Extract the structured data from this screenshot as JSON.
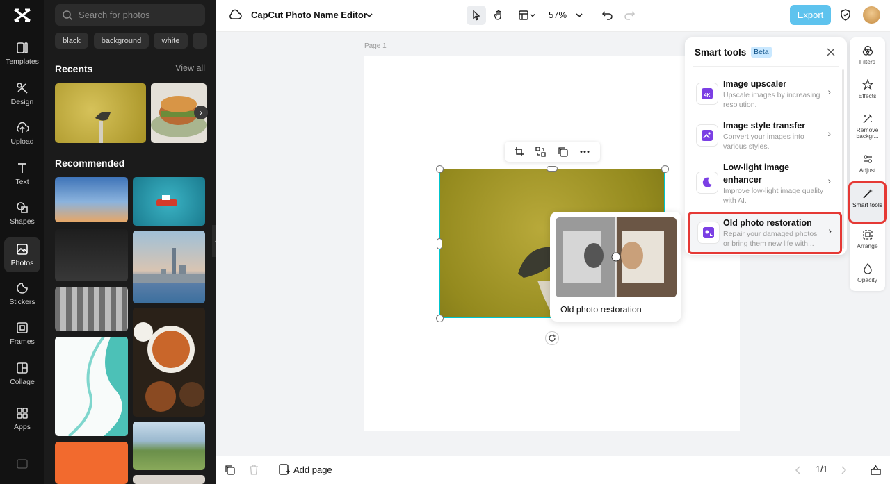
{
  "rail": {
    "items": [
      {
        "label": "Templates",
        "icon": "templates-icon"
      },
      {
        "label": "Design",
        "icon": "design-icon"
      },
      {
        "label": "Upload",
        "icon": "upload-icon"
      },
      {
        "label": "Text",
        "icon": "text-icon"
      },
      {
        "label": "Shapes",
        "icon": "shapes-icon"
      },
      {
        "label": "Photos",
        "icon": "photos-icon"
      },
      {
        "label": "Stickers",
        "icon": "stickers-icon"
      },
      {
        "label": "Frames",
        "icon": "frames-icon"
      },
      {
        "label": "Collage",
        "icon": "collage-icon"
      },
      {
        "label": "Apps",
        "icon": "apps-icon"
      }
    ]
  },
  "panel": {
    "search_placeholder": "Search for photos",
    "chips": [
      "black",
      "background",
      "white"
    ],
    "recents_title": "Recents",
    "view_all": "View all",
    "recommended_title": "Recommended"
  },
  "topbar": {
    "title": "CapCut Photo Name Editor",
    "zoom": "57%",
    "export_label": "Export"
  },
  "canvas": {
    "page_label": "Page 1"
  },
  "smart_tools": {
    "title": "Smart tools",
    "badge": "Beta",
    "tools": [
      {
        "name": "Image upscaler",
        "desc": "Upscale images by increasing resolution."
      },
      {
        "name": "Image style transfer",
        "desc": "Convert your images into various styles."
      },
      {
        "name": "Low-light image enhancer",
        "desc": "Improve low-light image quality with AI."
      },
      {
        "name": "Old photo restoration",
        "desc": "Repair your damaged photos or bring them new life with..."
      }
    ]
  },
  "preview": {
    "caption": "Old photo restoration"
  },
  "right_bar": {
    "items": [
      {
        "label": "Filters",
        "icon": "filters-icon"
      },
      {
        "label": "Effects",
        "icon": "effects-icon"
      },
      {
        "label": "Remove backgr...",
        "icon": "remove-background-icon"
      },
      {
        "label": "Adjust",
        "icon": "adjust-icon"
      },
      {
        "label": "Smart tools",
        "icon": "smart-tools-icon"
      },
      {
        "label": "Arrange",
        "icon": "arrange-icon"
      },
      {
        "label": "Opacity",
        "icon": "opacity-icon"
      }
    ]
  },
  "bottombar": {
    "add_page": "Add page",
    "page_count": "1/1"
  },
  "colors": {
    "accent": "#00c4cc",
    "highlight": "#e53935",
    "export_bg": "#5ec3ee",
    "purple": "#7b3fe4",
    "beta_bg": "#c9e8ff"
  }
}
